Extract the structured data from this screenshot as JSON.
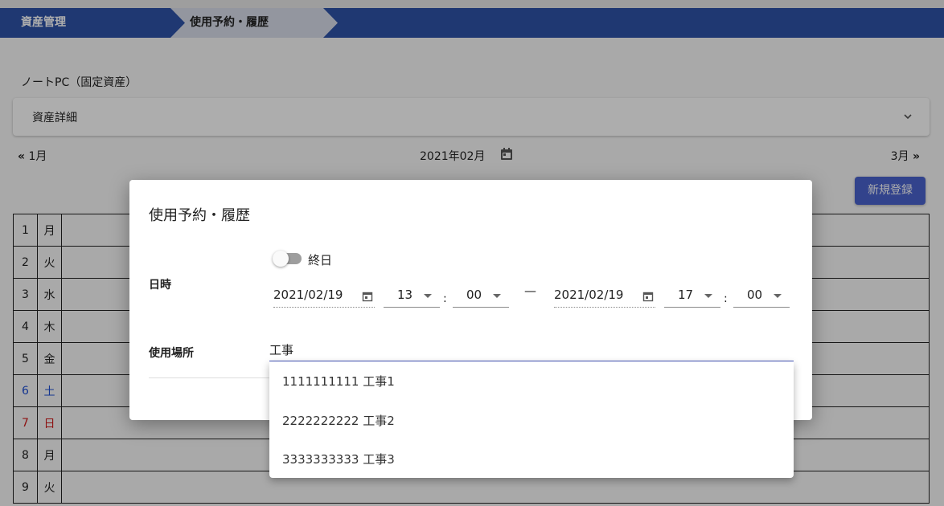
{
  "breadcrumb": {
    "items": [
      "資産管理",
      "使用予約・履歴"
    ]
  },
  "asset": {
    "title": "ノートPC（固定資産）",
    "detail_label": "資産詳細"
  },
  "month_nav": {
    "prev_label": "1月",
    "current_label": "2021年02月",
    "next_label": "3月"
  },
  "new_button_label": "新規登録",
  "calendar": {
    "rows": [
      {
        "day": "1",
        "dow": "月"
      },
      {
        "day": "2",
        "dow": "火"
      },
      {
        "day": "3",
        "dow": "水"
      },
      {
        "day": "4",
        "dow": "木"
      },
      {
        "day": "5",
        "dow": "金"
      },
      {
        "day": "6",
        "dow": "土"
      },
      {
        "day": "7",
        "dow": "日"
      },
      {
        "day": "8",
        "dow": "月"
      },
      {
        "day": "9",
        "dow": "火"
      }
    ]
  },
  "dialog": {
    "title": "使用予約・履歴",
    "allday_label": "終日",
    "datetime_label": "日時",
    "place_label": "使用場所",
    "start_date": "2021/02/19",
    "start_hour": "13",
    "start_minute": "00",
    "end_date": "2021/02/19",
    "end_hour": "17",
    "end_minute": "00",
    "time_separator": ":",
    "range_separator": "—",
    "place_value": "工事"
  },
  "place_options": [
    "1111111111 工事1",
    "2222222222 工事2",
    "3333333333 工事3"
  ],
  "colors": {
    "header_blue": "#2f53a8",
    "button_blue": "#4a63cf",
    "saturday": "#1e4fd4",
    "sunday": "#d01a1a"
  }
}
